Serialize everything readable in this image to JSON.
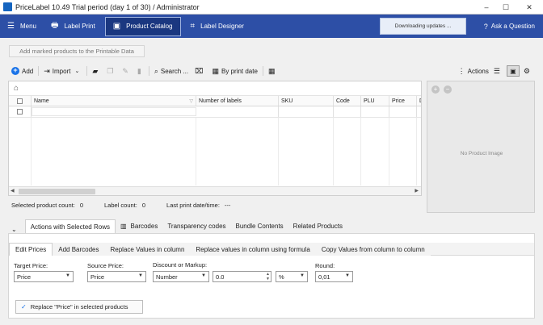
{
  "window": {
    "title": "PriceLabel 10.49 Trial period (day 1 of 30) / Administrator",
    "controls": [
      "–",
      "☐",
      "✕"
    ]
  },
  "nav": {
    "items": [
      {
        "label": "Menu",
        "icon": "☰"
      },
      {
        "label": "Label Print",
        "icon": "🖶"
      },
      {
        "label": "Product Catalog",
        "icon": "▣"
      },
      {
        "label": "Label Designer",
        "icon": "⌗"
      }
    ],
    "downloading": "Downloading updates ...",
    "ask": "Ask a Question",
    "ask_icon": "?"
  },
  "add_marked": "Add marked products to the Printable Data",
  "toolbar": {
    "add": "Add",
    "import": "Import",
    "search": "Search ...",
    "by_print_date": "By print date",
    "actions": "Actions"
  },
  "grid": {
    "columns": [
      "Name",
      "Number of labels",
      "SKU",
      "Code",
      "PLU",
      "Price",
      "D"
    ],
    "home_icon": "⌂"
  },
  "preview": {
    "no_image": "No Product Image"
  },
  "status": {
    "selected_label": "Selected product count:",
    "selected_value": "0",
    "label_count_label": "Label count:",
    "label_count_value": "0",
    "last_print_label": "Last print date/time:",
    "last_print_value": "---"
  },
  "tabs1": [
    "Actions with Selected Rows",
    "Barcodes",
    "Transparency codes",
    "Bundle Contents",
    "Related Products"
  ],
  "tabs2": [
    "Edit Prices",
    "Add Barcodes",
    "Replace Values in column",
    "Replace values in column using formula",
    "Copy Values from column to column"
  ],
  "form": {
    "target_label": "Target Price:",
    "target_value": "Price",
    "source_label": "Source Price:",
    "source_value": "Price",
    "discount_label": "Discount or Markup:",
    "discount_type": "Number",
    "discount_value": "0.0",
    "unit": "%",
    "round_label": "Round:",
    "round_value": "0,01",
    "replace_button": "Replace \"Price\" in selected products"
  },
  "colors": {
    "nav_bg": "#2d4fa6",
    "nav_active": "#1a3780",
    "accent": "#1a73e8"
  }
}
